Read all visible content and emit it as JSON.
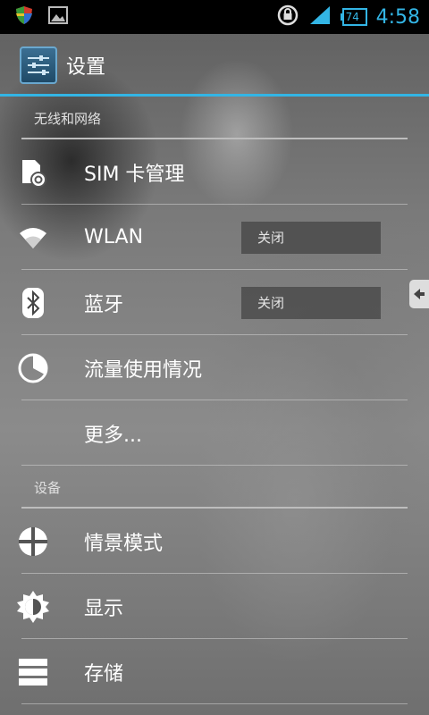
{
  "status_bar": {
    "time": "4:58",
    "battery": "74",
    "icons": [
      "shield-icon",
      "image-icon",
      "rotation-lock-icon",
      "signal-icon",
      "battery-icon"
    ]
  },
  "action_bar": {
    "title": "设置",
    "icon": "settings-icon"
  },
  "sections": [
    {
      "header": "无线和网络",
      "items": [
        {
          "label": "SIM 卡管理",
          "icon": "sim-icon"
        },
        {
          "label": "WLAN",
          "icon": "wifi-icon",
          "toggle": "关闭"
        },
        {
          "label": "蓝牙",
          "icon": "bluetooth-icon",
          "toggle": "关闭"
        },
        {
          "label": "流量使用情况",
          "icon": "data-usage-icon"
        },
        {
          "label": "更多..."
        }
      ]
    },
    {
      "header": "设备",
      "items": [
        {
          "label": "情景模式",
          "icon": "profiles-icon"
        },
        {
          "label": "显示",
          "icon": "display-icon"
        },
        {
          "label": "存储",
          "icon": "storage-icon"
        }
      ]
    }
  ],
  "colors": {
    "accent": "#33b5e5",
    "status_bar_bg": "#000000"
  }
}
